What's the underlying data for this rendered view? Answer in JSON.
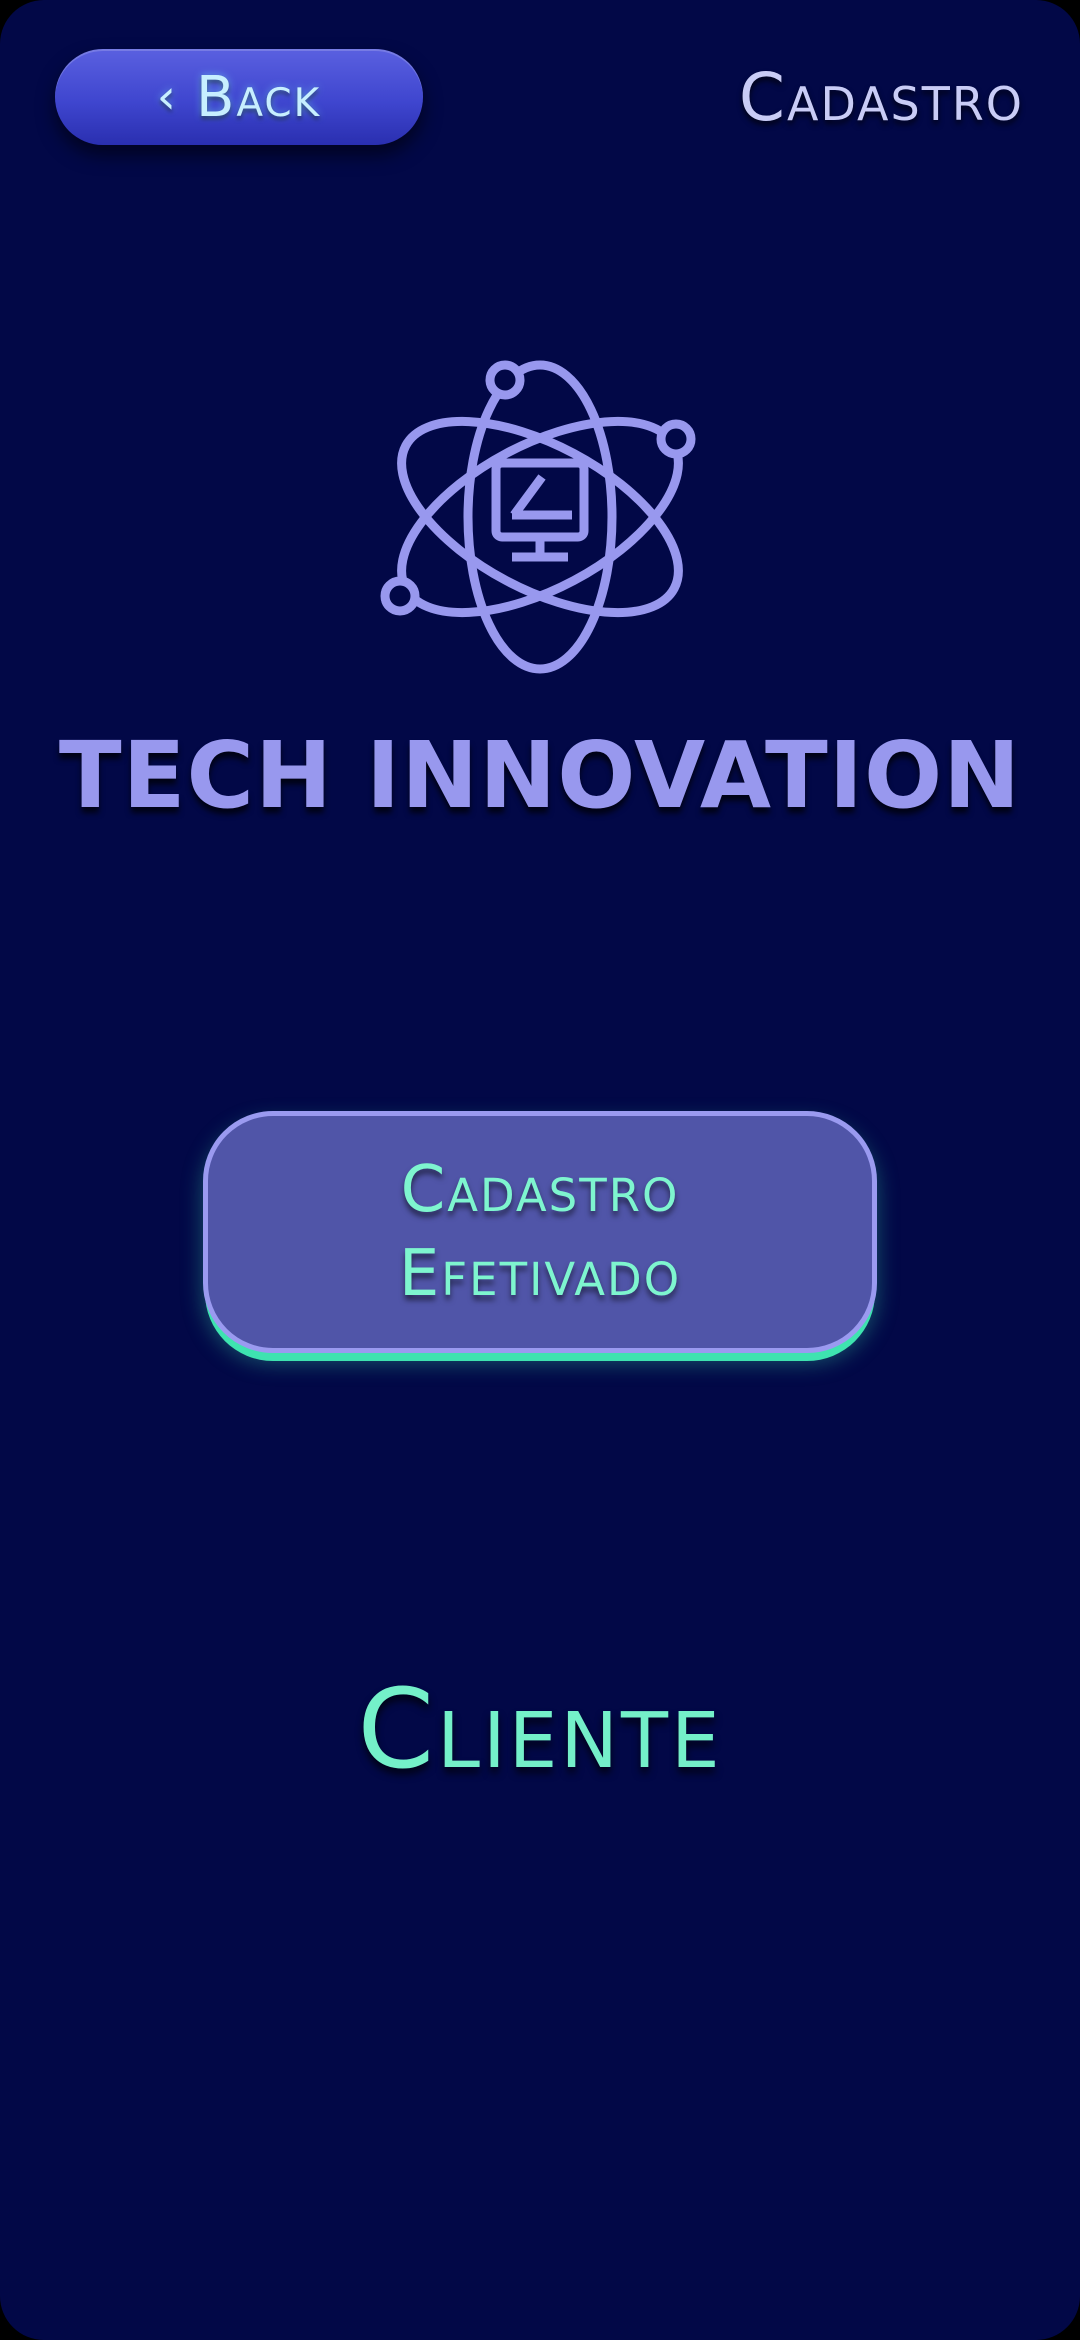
{
  "header": {
    "back_icon": "chevron-left-icon",
    "back_label": "Back",
    "title": "Cadastro"
  },
  "logo": {
    "icon": "atom-monitor-icon",
    "brand_name": "TECH INNOVATION"
  },
  "status": {
    "line1": "Cadastro",
    "line2": "Efetivado"
  },
  "client_label": "Cliente",
  "colors": {
    "background": "#020847",
    "accent": "#9898ee",
    "mint": "#74f0c9",
    "button_fill": "#5055a8"
  }
}
